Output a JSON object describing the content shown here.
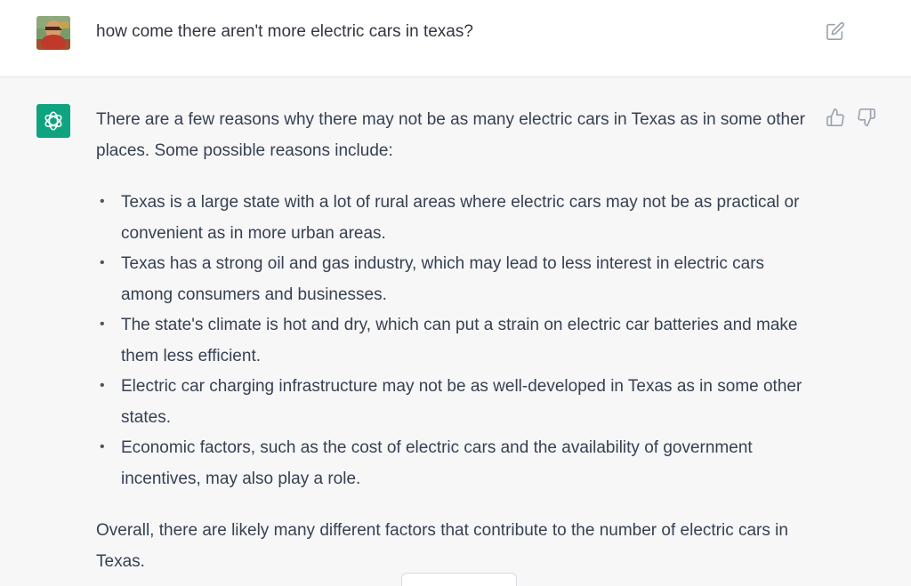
{
  "user_message": {
    "text": "how come there aren't more electric cars in texas?",
    "edit_icon": "pencil-square-icon"
  },
  "assistant_message": {
    "intro": "There are a few reasons why there may not be as many electric cars in Texas as in some other places. Some possible reasons include:",
    "bullets": [
      {
        "text": "Texas is a large state with a lot of rural areas where electric cars may not be as practical or convenient as in more urban areas."
      },
      {
        "text": "Texas has a strong oil and gas industry, which may lead to less interest in electric cars among consumers and businesses."
      },
      {
        "text": "The state's climate is hot and dry, which can put a strain on electric car batteries and make them less efficient."
      },
      {
        "text": "Electric car charging infrastructure may not be as well-developed in Texas as in some other states."
      },
      {
        "text": "Economic factors, such as the cost of electric cars and the availability of government incentives, may also play a role."
      }
    ],
    "conclusion": "Overall, there are likely many different factors that contribute to the number of electric cars in Texas.",
    "feedback_icons": [
      "thumbs-up-icon",
      "thumbs-down-icon"
    ]
  },
  "colors": {
    "user_background": "#ffffff",
    "assistant_background": "#f7f7f8",
    "brand_green": "#10a37f",
    "text": "#374151"
  }
}
